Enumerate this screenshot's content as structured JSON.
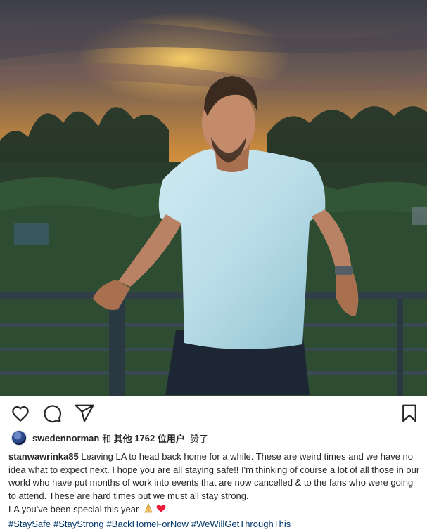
{
  "post": {
    "photo_icon": "person-at-sunset-photo",
    "actions": {
      "like_icon": "heart-icon",
      "comment_icon": "comment-icon",
      "share_icon": "share-icon",
      "save_icon": "bookmark-icon"
    },
    "likes": {
      "liker_username": "swedennorman",
      "text_and": "和",
      "text_others": "其他",
      "count": "1762",
      "text_users": "位用户",
      "text_liked": "赞了"
    },
    "caption": {
      "username": "stanwawrinka85",
      "text": "Leaving LA to head back home for a while. These are weird times and we have no idea what to expect next. I hope you are all staying safe!! I'm thinking of course a lot of all those in our world who have put months of work into events that are now cancelled & to the fans who were going to attend. These are hard times but we must all stay strong.",
      "last_line": "LA you've been special this year",
      "emojis": [
        "folded-hands-icon",
        "red-heart-icon"
      ],
      "hashtags": [
        "#StaySafe",
        "#StayStrong",
        "#BackHomeForNow",
        "#WeWillGetThroughThis"
      ]
    },
    "colors": {
      "hashtag": "#00376b",
      "text": "#262626",
      "heart": "#ed1c3c"
    }
  }
}
